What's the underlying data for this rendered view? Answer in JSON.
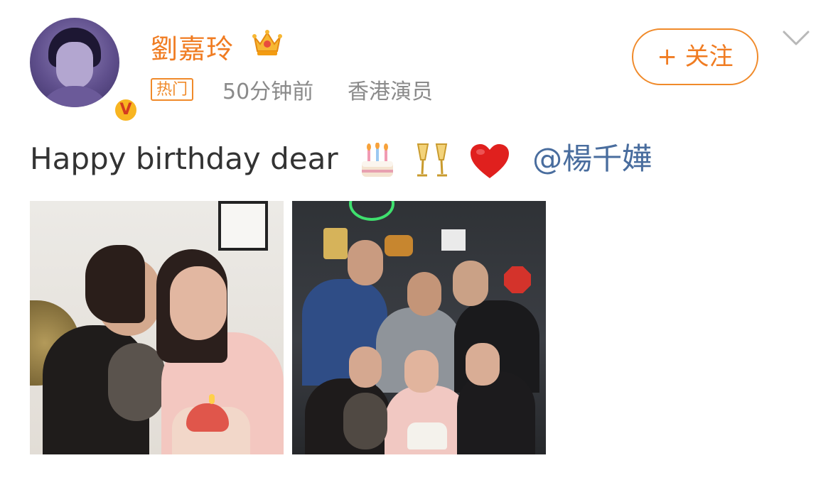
{
  "post": {
    "username": "劉嘉玲",
    "hot_tag": "热门",
    "time": "50分钟前",
    "role": "香港演员",
    "follow_label": "+ 关注",
    "verified_badge": "V",
    "text_prefix": "Happy birthday dear",
    "mention": "@楊千嬅",
    "emojis": [
      "birthday-cake-icon",
      "champagne-glasses-icon",
      "red-heart-icon"
    ],
    "photo_count": 2
  },
  "colors": {
    "accent_orange": "#f07c22",
    "mention_blue": "#496d9e",
    "meta_gray": "#8a8a8a"
  }
}
